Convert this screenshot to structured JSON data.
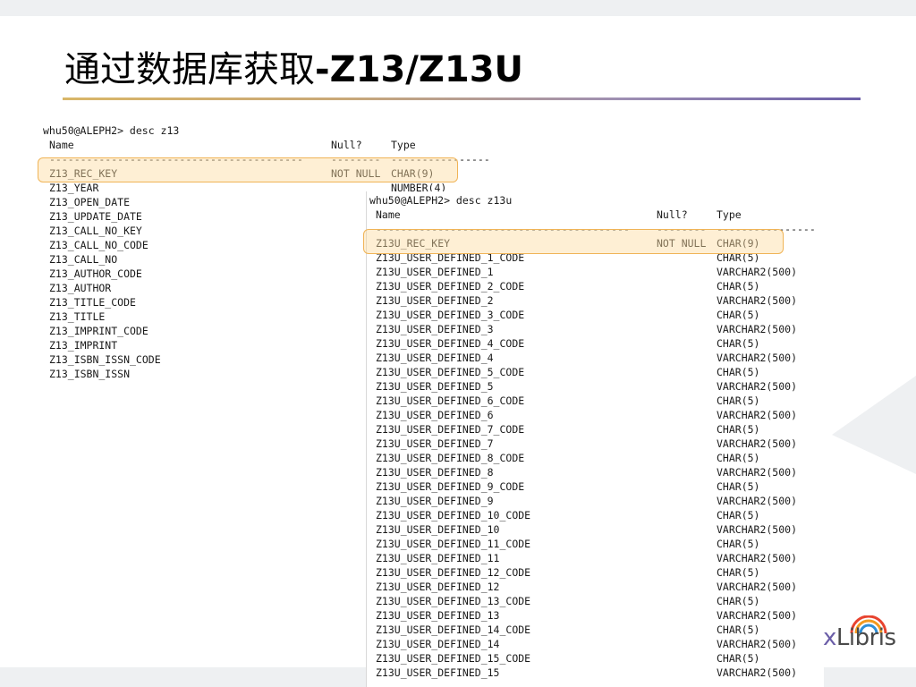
{
  "slide": {
    "title_cn": "通过数据库获取",
    "title_latin": "-Z13/Z13U"
  },
  "term1": {
    "prompt": "whu50@ALEPH2> desc z13",
    "header_name": "Name",
    "header_null": "Null?",
    "header_type": "Type",
    "dash_name": "-----------------------------------------",
    "dash_null": "--------",
    "dash_type": "----------------",
    "rows": [
      {
        "name": "Z13_REC_KEY",
        "null": "NOT NULL",
        "type": "CHAR(9)"
      },
      {
        "name": "Z13_YEAR",
        "null": "",
        "type": "NUMBER(4)"
      },
      {
        "name": "Z13_OPEN_DATE",
        "null": "",
        "type": ""
      },
      {
        "name": "Z13_UPDATE_DATE",
        "null": "",
        "type": ""
      },
      {
        "name": "Z13_CALL_NO_KEY",
        "null": "",
        "type": ""
      },
      {
        "name": "Z13_CALL_NO_CODE",
        "null": "",
        "type": ""
      },
      {
        "name": "Z13_CALL_NO",
        "null": "",
        "type": ""
      },
      {
        "name": "Z13_AUTHOR_CODE",
        "null": "",
        "type": ""
      },
      {
        "name": "Z13_AUTHOR",
        "null": "",
        "type": ""
      },
      {
        "name": "Z13_TITLE_CODE",
        "null": "",
        "type": ""
      },
      {
        "name": "Z13_TITLE",
        "null": "",
        "type": ""
      },
      {
        "name": "Z13_IMPRINT_CODE",
        "null": "",
        "type": ""
      },
      {
        "name": "Z13_IMPRINT",
        "null": "",
        "type": ""
      },
      {
        "name": "Z13_ISBN_ISSN_CODE",
        "null": "",
        "type": ""
      },
      {
        "name": "Z13_ISBN_ISSN",
        "null": "",
        "type": ""
      }
    ]
  },
  "term2": {
    "prompt": "whu50@ALEPH2> desc z13u",
    "header_name": "Name",
    "header_null": "Null?",
    "header_type": "Type",
    "dash_name": "-----------------------------------------",
    "dash_null": "--------",
    "dash_type": "----------------",
    "rows": [
      {
        "name": "Z13U_REC_KEY",
        "null": "NOT NULL",
        "type": "CHAR(9)"
      },
      {
        "name": "Z13U_USER_DEFINED_1_CODE",
        "null": "",
        "type": "CHAR(5)"
      },
      {
        "name": "Z13U_USER_DEFINED_1",
        "null": "",
        "type": "VARCHAR2(500)"
      },
      {
        "name": "Z13U_USER_DEFINED_2_CODE",
        "null": "",
        "type": "CHAR(5)"
      },
      {
        "name": "Z13U_USER_DEFINED_2",
        "null": "",
        "type": "VARCHAR2(500)"
      },
      {
        "name": "Z13U_USER_DEFINED_3_CODE",
        "null": "",
        "type": "CHAR(5)"
      },
      {
        "name": "Z13U_USER_DEFINED_3",
        "null": "",
        "type": "VARCHAR2(500)"
      },
      {
        "name": "Z13U_USER_DEFINED_4_CODE",
        "null": "",
        "type": "CHAR(5)"
      },
      {
        "name": "Z13U_USER_DEFINED_4",
        "null": "",
        "type": "VARCHAR2(500)"
      },
      {
        "name": "Z13U_USER_DEFINED_5_CODE",
        "null": "",
        "type": "CHAR(5)"
      },
      {
        "name": "Z13U_USER_DEFINED_5",
        "null": "",
        "type": "VARCHAR2(500)"
      },
      {
        "name": "Z13U_USER_DEFINED_6_CODE",
        "null": "",
        "type": "CHAR(5)"
      },
      {
        "name": "Z13U_USER_DEFINED_6",
        "null": "",
        "type": "VARCHAR2(500)"
      },
      {
        "name": "Z13U_USER_DEFINED_7_CODE",
        "null": "",
        "type": "CHAR(5)"
      },
      {
        "name": "Z13U_USER_DEFINED_7",
        "null": "",
        "type": "VARCHAR2(500)"
      },
      {
        "name": "Z13U_USER_DEFINED_8_CODE",
        "null": "",
        "type": "CHAR(5)"
      },
      {
        "name": "Z13U_USER_DEFINED_8",
        "null": "",
        "type": "VARCHAR2(500)"
      },
      {
        "name": "Z13U_USER_DEFINED_9_CODE",
        "null": "",
        "type": "CHAR(5)"
      },
      {
        "name": "Z13U_USER_DEFINED_9",
        "null": "",
        "type": "VARCHAR2(500)"
      },
      {
        "name": "Z13U_USER_DEFINED_10_CODE",
        "null": "",
        "type": "CHAR(5)"
      },
      {
        "name": "Z13U_USER_DEFINED_10",
        "null": "",
        "type": "VARCHAR2(500)"
      },
      {
        "name": "Z13U_USER_DEFINED_11_CODE",
        "null": "",
        "type": "CHAR(5)"
      },
      {
        "name": "Z13U_USER_DEFINED_11",
        "null": "",
        "type": "VARCHAR2(500)"
      },
      {
        "name": "Z13U_USER_DEFINED_12_CODE",
        "null": "",
        "type": "CHAR(5)"
      },
      {
        "name": "Z13U_USER_DEFINED_12",
        "null": "",
        "type": "VARCHAR2(500)"
      },
      {
        "name": "Z13U_USER_DEFINED_13_CODE",
        "null": "",
        "type": "CHAR(5)"
      },
      {
        "name": "Z13U_USER_DEFINED_13",
        "null": "",
        "type": "VARCHAR2(500)"
      },
      {
        "name": "Z13U_USER_DEFINED_14_CODE",
        "null": "",
        "type": "CHAR(5)"
      },
      {
        "name": "Z13U_USER_DEFINED_14",
        "null": "",
        "type": "VARCHAR2(500)"
      },
      {
        "name": "Z13U_USER_DEFINED_15_CODE",
        "null": "",
        "type": "CHAR(5)"
      },
      {
        "name": "Z13U_USER_DEFINED_15",
        "null": "",
        "type": "VARCHAR2(500)"
      }
    ]
  },
  "logo": {
    "text": "Libris",
    "prefix": "x",
    "arc_colors": [
      "#e8432f",
      "#f29a1f",
      "#2f8fd6",
      "#6b5ea8"
    ]
  },
  "colors": {
    "highlight_border": "#f0b457",
    "highlight_fill": "#fcdca0"
  }
}
